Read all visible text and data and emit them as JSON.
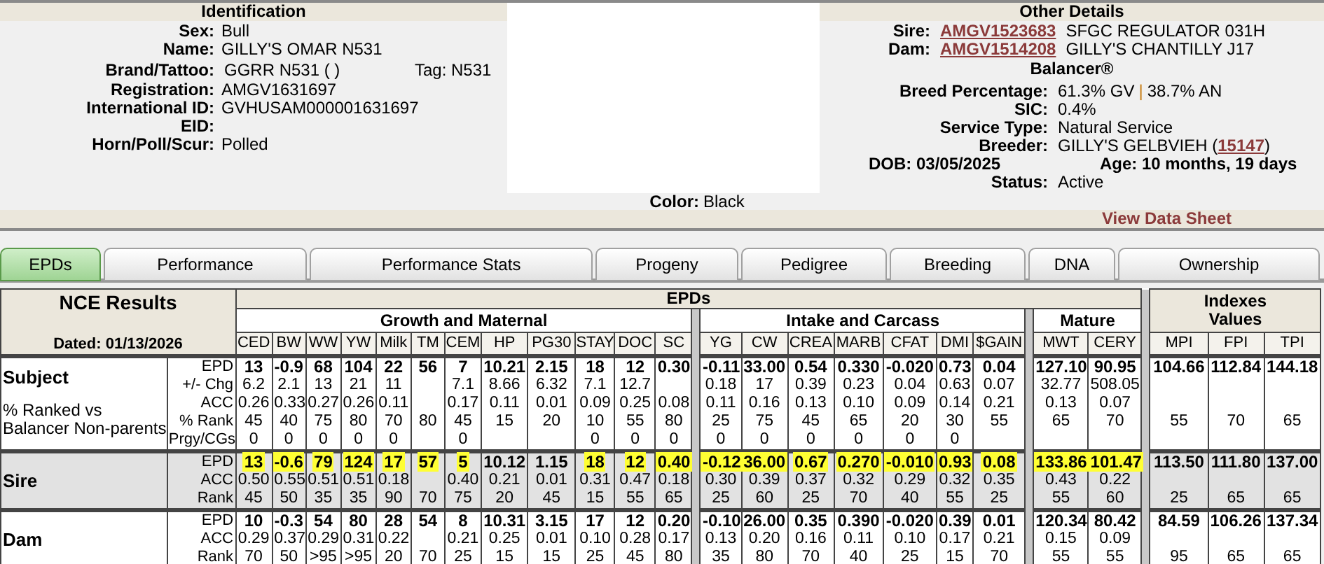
{
  "identification": {
    "title": "Identification",
    "fields": [
      {
        "label": "Sex:",
        "value": "Bull"
      },
      {
        "label": "Name:",
        "value": "GILLY'S OMAR N531"
      },
      {
        "label": "Brand/Tattoo:",
        "value": "GGRR N531 ( )",
        "tag": "Tag: N531"
      },
      {
        "label": "Registration:",
        "value": "AMGV1631697"
      },
      {
        "label": "International ID:",
        "value": "GVHUSAM000001631697"
      },
      {
        "label": "EID:"
      },
      {
        "label": "Horn/Poll/Scur:",
        "value": "Polled"
      }
    ]
  },
  "color": {
    "label": "Color:",
    "value": "Black"
  },
  "other_details": {
    "title": "Other Details",
    "parents": [
      {
        "label": "Sire:",
        "id": "AMGV1523683",
        "name": "SFGC REGULATOR 031H"
      },
      {
        "label": "Dam:",
        "id": "AMGV1514208",
        "name": "GILLY'S CHANTILLY J17"
      }
    ],
    "program": "Balancer®",
    "breed_percentage": {
      "label": "Breed Percentage:",
      "first": "61.3% GV",
      "separator": "|",
      "second": "38.7% AN"
    },
    "fields": [
      {
        "label": "SIC:",
        "value": "0.4%"
      },
      {
        "label": "Service Type:",
        "value": "Natural Service"
      }
    ],
    "breeder": {
      "label": "Breeder:",
      "name": "GILLY'S GELBVIEH (",
      "id": "15147",
      "close": ")"
    },
    "dob": {
      "label": "DOB:",
      "value": "03/05/2025"
    },
    "age": {
      "label": "Age:",
      "value": "10 months, 19 days"
    },
    "status": {
      "label": "Status:",
      "value": "Active"
    }
  },
  "view_data_sheet": "View Data Sheet",
  "tabs": [
    {
      "label": "EPDs",
      "selected": true
    },
    {
      "label": "Performance",
      "selected": false
    },
    {
      "label": "Performance Stats",
      "selected": false
    },
    {
      "label": "Progeny",
      "selected": false
    },
    {
      "label": "Pedigree",
      "selected": false
    },
    {
      "label": "Breeding",
      "selected": false
    },
    {
      "label": "DNA",
      "selected": false
    },
    {
      "label": "Ownership",
      "selected": false
    }
  ],
  "nce": {
    "title": "NCE Results",
    "dated": "Dated: 01/13/2026",
    "epds_heading": "EPDs",
    "indexes_heading": "Indexes Values",
    "rows": [
      {
        "name": "Subject",
        "shaded": false,
        "note": "% Ranked vs Balancer Non-parents",
        "line_labels": [
          "EPD",
          "+/- Chg",
          "ACC",
          "% Rank",
          "Prgy/CGs"
        ]
      },
      {
        "name": "Sire",
        "shaded": true,
        "line_labels": [
          "EPD",
          "ACC",
          "Rank"
        ]
      },
      {
        "name": "Dam",
        "shaded": false,
        "line_labels": [
          "EPD",
          "ACC",
          "Rank"
        ]
      }
    ],
    "groups": [
      {
        "name": "Growth and Maternal",
        "columns": [
          {
            "name": "CED",
            "subject": {
              "epd": "13",
              "change": "6.2",
              "acc": "0.26",
              "rank": "45",
              "progeny": "0"
            },
            "sire": {
              "epd": "13",
              "highlighted": true,
              "acc": "0.50",
              "rank": "45"
            },
            "dam": {
              "epd": "10",
              "acc": "0.29",
              "rank": "70"
            }
          },
          {
            "name": "BW",
            "subject": {
              "epd": "-0.9",
              "change": "2.1",
              "acc": "0.33",
              "rank": "40",
              "progeny": "0"
            },
            "sire": {
              "epd": "-0.6",
              "highlighted": true,
              "acc": "0.55",
              "rank": "50"
            },
            "dam": {
              "epd": "-0.3",
              "acc": "0.37",
              "rank": "50"
            }
          },
          {
            "name": "WW",
            "subject": {
              "epd": "68",
              "change": "13",
              "acc": "0.27",
              "rank": "75",
              "progeny": "0"
            },
            "sire": {
              "epd": "79",
              "highlighted": true,
              "acc": "0.51",
              "rank": "35"
            },
            "dam": {
              "epd": "54",
              "acc": "0.29",
              "rank": ">95"
            }
          },
          {
            "name": "YW",
            "subject": {
              "epd": "104",
              "change": "21",
              "acc": "0.26",
              "rank": "80",
              "progeny": "0"
            },
            "sire": {
              "epd": "124",
              "highlighted": true,
              "acc": "0.51",
              "rank": "35"
            },
            "dam": {
              "epd": "80",
              "acc": "0.31",
              "rank": ">95"
            }
          },
          {
            "name": "Milk",
            "subject": {
              "epd": "22",
              "change": "11",
              "acc": "0.11",
              "rank": "70",
              "progeny": "0"
            },
            "sire": {
              "epd": "17",
              "highlighted": true,
              "acc": "0.18",
              "rank": "90"
            },
            "dam": {
              "epd": "28",
              "acc": "0.22",
              "rank": "20"
            }
          },
          {
            "name": "TM",
            "subject": {
              "epd": "56",
              "rank": "80"
            },
            "sire": {
              "epd": "57",
              "highlighted": true,
              "rank": "70"
            },
            "dam": {
              "epd": "54",
              "rank": "70"
            }
          },
          {
            "name": "CEM",
            "subject": {
              "epd": "7",
              "change": "7.1",
              "acc": "0.17",
              "rank": "45",
              "progeny": "0"
            },
            "sire": {
              "epd": "5",
              "highlighted": true,
              "acc": "0.40",
              "rank": "75"
            },
            "dam": {
              "epd": "8",
              "acc": "0.21",
              "rank": "25"
            }
          },
          {
            "name": "HP",
            "subject": {
              "epd": "10.21",
              "change": "8.66",
              "acc": "0.11",
              "rank": "15"
            },
            "sire": {
              "epd": "10.12",
              "highlighted": false,
              "acc": "0.21",
              "rank": "20"
            },
            "dam": {
              "epd": "10.31",
              "acc": "0.25",
              "rank": "15"
            }
          },
          {
            "name": "PG30",
            "subject": {
              "epd": "2.15",
              "change": "6.32",
              "acc": "0.01",
              "rank": "20"
            },
            "sire": {
              "epd": "1.15",
              "highlighted": false,
              "acc": "0.01",
              "rank": "45"
            },
            "dam": {
              "epd": "3.15",
              "acc": "0.01",
              "rank": "15"
            }
          },
          {
            "name": "STAY",
            "subject": {
              "epd": "18",
              "change": "7.1",
              "acc": "0.09",
              "rank": "10",
              "progeny": "0"
            },
            "sire": {
              "epd": "18",
              "highlighted": true,
              "acc": "0.31",
              "rank": "15"
            },
            "dam": {
              "epd": "17",
              "acc": "0.10",
              "rank": "25"
            }
          },
          {
            "name": "DOC",
            "subject": {
              "epd": "12",
              "change": "12.7",
              "acc": "0.25",
              "rank": "55",
              "progeny": "0"
            },
            "sire": {
              "epd": "12",
              "highlighted": true,
              "acc": "0.47",
              "rank": "55"
            },
            "dam": {
              "epd": "12",
              "acc": "0.28",
              "rank": "45"
            }
          },
          {
            "name": "SC",
            "subject": {
              "epd": "0.30",
              "acc": "0.08",
              "rank": "80",
              "progeny": "0"
            },
            "sire": {
              "epd": "0.40",
              "highlighted": true,
              "acc": "0.18",
              "rank": "65"
            },
            "dam": {
              "epd": "0.20",
              "acc": "0.17",
              "rank": "80"
            }
          }
        ]
      },
      {
        "name": "Intake and Carcass",
        "columns": [
          {
            "name": "YG",
            "subject": {
              "epd": "-0.11",
              "change": "0.18",
              "acc": "0.11",
              "rank": "25",
              "progeny": "0"
            },
            "sire": {
              "epd": "-0.12",
              "highlighted": true,
              "acc": "0.30",
              "rank": "25"
            },
            "dam": {
              "epd": "-0.10",
              "acc": "0.13",
              "rank": "35"
            }
          },
          {
            "name": "CW",
            "subject": {
              "epd": "33.00",
              "change": "17",
              "acc": "0.16",
              "rank": "75",
              "progeny": "0"
            },
            "sire": {
              "epd": "36.00",
              "highlighted": true,
              "acc": "0.39",
              "rank": "60"
            },
            "dam": {
              "epd": "26.00",
              "acc": "0.20",
              "rank": "80"
            }
          },
          {
            "name": "CREA",
            "subject": {
              "epd": "0.54",
              "change": "0.39",
              "acc": "0.13",
              "rank": "45",
              "progeny": "0"
            },
            "sire": {
              "epd": "0.67",
              "highlighted": true,
              "acc": "0.37",
              "rank": "25"
            },
            "dam": {
              "epd": "0.35",
              "acc": "0.16",
              "rank": "70"
            }
          },
          {
            "name": "MARB",
            "subject": {
              "epd": "0.330",
              "change": "0.23",
              "acc": "0.10",
              "rank": "65",
              "progeny": "0"
            },
            "sire": {
              "epd": "0.270",
              "highlighted": true,
              "acc": "0.32",
              "rank": "70"
            },
            "dam": {
              "epd": "0.390",
              "acc": "0.11",
              "rank": "40"
            }
          },
          {
            "name": "CFAT",
            "subject": {
              "epd": "-0.020",
              "change": "0.04",
              "acc": "0.09",
              "rank": "20",
              "progeny": "0"
            },
            "sire": {
              "epd": "-0.010",
              "highlighted": true,
              "acc": "0.29",
              "rank": "40"
            },
            "dam": {
              "epd": "-0.020",
              "acc": "0.10",
              "rank": "25"
            }
          },
          {
            "name": "DMI",
            "subject": {
              "epd": "0.73",
              "change": "0.63",
              "acc": "0.14",
              "rank": "30",
              "progeny": "0"
            },
            "sire": {
              "epd": "0.93",
              "highlighted": true,
              "acc": "0.32",
              "rank": "55"
            },
            "dam": {
              "epd": "0.39",
              "acc": "0.17",
              "rank": "15"
            }
          },
          {
            "name": "$GAIN",
            "subject": {
              "epd": "0.04",
              "change": "0.07",
              "acc": "0.21",
              "rank": "55"
            },
            "sire": {
              "epd": "0.08",
              "highlighted": true,
              "acc": "0.35",
              "rank": "25"
            },
            "dam": {
              "epd": "0.01",
              "acc": "0.21",
              "rank": "70"
            }
          }
        ]
      },
      {
        "name": "Mature",
        "columns": [
          {
            "name": "MWT",
            "subject": {
              "epd": "127.10",
              "change": "32.77",
              "acc": "0.13",
              "rank": "65"
            },
            "sire": {
              "epd": "133.86",
              "highlighted": true,
              "acc": "0.43",
              "rank": "55"
            },
            "dam": {
              "epd": "120.34",
              "acc": "0.15",
              "rank": "55"
            }
          },
          {
            "name": "CERY",
            "subject": {
              "epd": "90.95",
              "change": "508.05",
              "acc": "0.07",
              "rank": "70"
            },
            "sire": {
              "epd": "101.47",
              "highlighted": true,
              "acc": "0.22",
              "rank": "60"
            },
            "dam": {
              "epd": "80.42",
              "acc": "0.09",
              "rank": "55"
            }
          }
        ]
      }
    ],
    "index_columns": [
      {
        "name": "MPI",
        "subject": {
          "epd": "104.66",
          "rank": "55"
        },
        "sire": {
          "epd": "113.50",
          "highlighted": false,
          "rank": "25"
        },
        "dam": {
          "epd": "84.59",
          "rank": "95"
        }
      },
      {
        "name": "FPI",
        "subject": {
          "epd": "112.84",
          "rank": "70"
        },
        "sire": {
          "epd": "111.80",
          "highlighted": false,
          "rank": "65"
        },
        "dam": {
          "epd": "106.26",
          "rank": "65"
        }
      },
      {
        "name": "TPI",
        "subject": {
          "epd": "144.18",
          "rank": "65"
        },
        "sire": {
          "epd": "137.00",
          "highlighted": false,
          "rank": "65"
        },
        "dam": {
          "epd": "137.34",
          "rank": "65"
        }
      }
    ]
  }
}
